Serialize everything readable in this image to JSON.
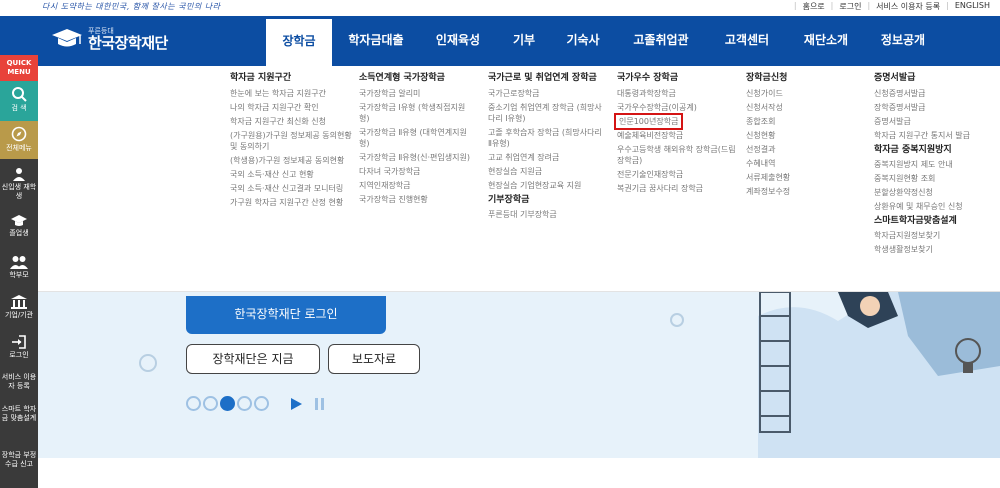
{
  "topbar": {
    "slogan": "다시 도약하는 대한민국, 함께 잘사는 국민의 나라",
    "links": [
      "홈으로",
      "로그인",
      "서비스 이용자 등록",
      "ENGLISH"
    ]
  },
  "logo": {
    "sub": "푸른등대",
    "main": "한국장학재단"
  },
  "gnb": [
    {
      "label": "장학금",
      "active": true
    },
    {
      "label": "학자금대출"
    },
    {
      "label": "인재육성"
    },
    {
      "label": "기부"
    },
    {
      "label": "기숙사"
    },
    {
      "label": "고졸취업관"
    },
    {
      "label": "고객센터"
    },
    {
      "label": "재단소개"
    },
    {
      "label": "정보공개"
    }
  ],
  "quick": {
    "title": "QUICK MENU",
    "items": [
      "검 색",
      "전체메뉴",
      "신입생 재학생",
      "졸업생",
      "학부모",
      "기업/기관",
      "로그인",
      "서비스 이용자 등록",
      "스마트 학자금 맞춤설계",
      "장학금 부정수급 신고"
    ]
  },
  "mega": {
    "cols": [
      {
        "title": "학자금 지원구간",
        "items": [
          "한눈에 보는 학자금 지원구간",
          "나의 학자금 지원구간 확인",
          "학자금 지원구간 최신화 신청",
          "(가구원용)가구원 정보제공 동의현황 및 동의하기",
          "(학생용)가구원 정보제공 동의현황",
          "국외 소득·재산 신고 현황",
          "국외 소득·재산 신고결과 모니터링",
          "가구원 학자금 지원구간 산정 현황"
        ]
      },
      {
        "title": "소득연계형 국가장학금",
        "items": [
          "국가장학금 알리미",
          "국가장학금 Ⅰ유형 (학생직접지원형)",
          "국가장학금 Ⅱ유형 (대학연계지원형)",
          "국가장학금 Ⅱ유형(신·편입생지원)",
          "다자녀 국가장학금",
          "지역인재장학금",
          "국가장학금 진행현황"
        ]
      },
      {
        "title": "국가근로 및 취업연계 장학금",
        "items": [
          "국가근로장학금",
          "중소기업 취업연계 장학금 (희망사다리 Ⅰ유형)",
          "고졸 후학습자 장학금 (희망사다리 Ⅱ유형)",
          "고교 취업연계 장려금",
          "현장실습 지원금",
          "현장실습 기업현장교육 지원"
        ],
        "subtitle": "기부장학금",
        "subitems": [
          "푸른등대 기부장학금"
        ]
      },
      {
        "title": "국가우수 장학금",
        "items": [
          "대통령과학장학금",
          "국가우수장학금(이공계)",
          "인문100년장학금",
          "예술체육비전장학금",
          "우수고등학생 해외유학 장학금(드림장학금)",
          "전문기술인재장학금",
          "복권기금 꿈사다리 장학금"
        ],
        "highlight": "인문100년장학금"
      },
      {
        "title": "장학금신청",
        "items": [
          "신청가이드",
          "신청서작성",
          "종합조회",
          "신청현황",
          "선정결과",
          "수혜내역",
          "서류제출현황",
          "계좌정보수정"
        ]
      },
      {
        "title": "증명서발급",
        "items": [
          "신청증명서발급",
          "장학증명서발급",
          "증명서발급",
          "학자금 지원구간 통지서 발급"
        ],
        "subtitle": "학자금 중복지원방지",
        "subitems": [
          "중복지원방지 제도 안내",
          "중복지원현황 조회",
          "분할상환약정신청",
          "상환유예 및 채무승인 신청"
        ],
        "subtitle2": "스마트학자금맞춤설계",
        "subitems2": [
          "학자금지원정보찾기",
          "학생생활정보찾기"
        ]
      }
    ]
  },
  "hero": {
    "login_label": "한국장학재단 로그인",
    "btn_now": "장학재단은 지금",
    "btn_press": "보도자료"
  },
  "colors": {
    "primary": "#0c4da2",
    "accent_red": "#d41414",
    "button_blue": "#1d6fc7"
  }
}
